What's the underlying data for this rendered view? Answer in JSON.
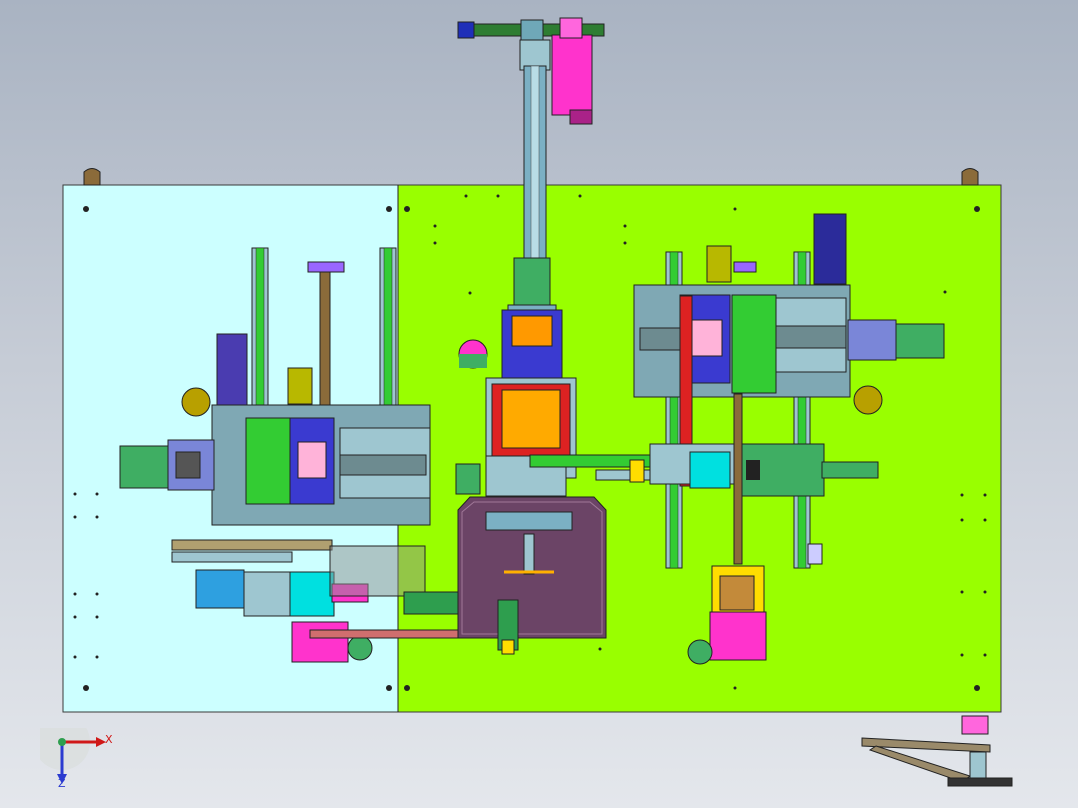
{
  "viewport": {
    "background_top": "#a9b3c2",
    "background_bottom": "#e4e7ec"
  },
  "plates": {
    "left_color": "#ccffff",
    "right_color": "#99ff00"
  },
  "triad": {
    "x_label": "X",
    "z_label": "Z",
    "x_color": "#d01818",
    "z_color": "#2b3bd0"
  }
}
